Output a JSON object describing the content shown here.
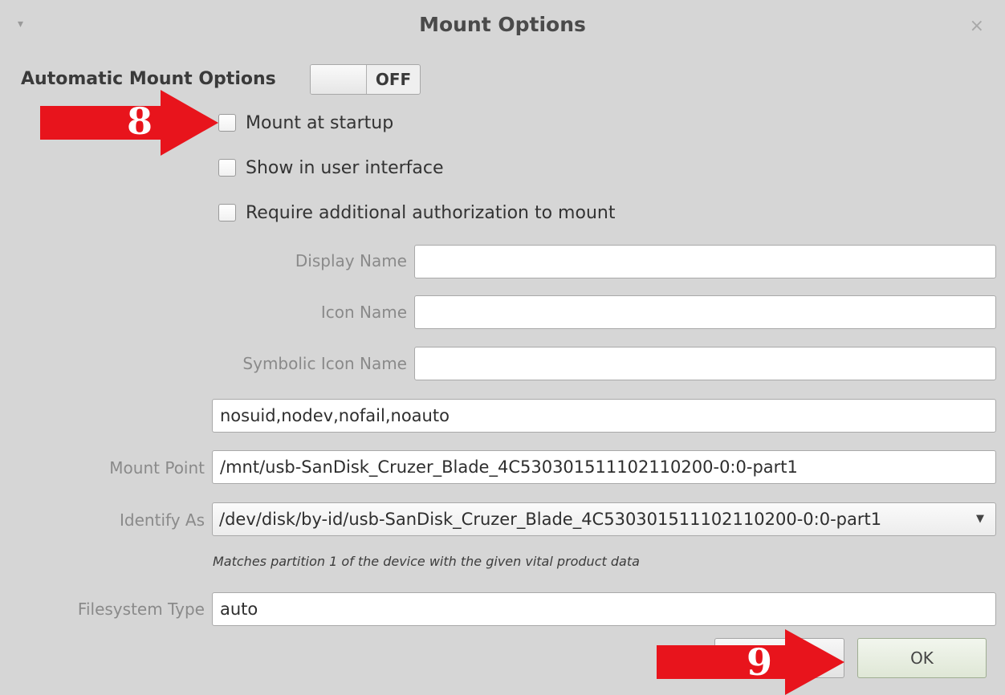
{
  "dialog": {
    "title": "Mount Options",
    "close_glyph": "×",
    "menu_glyph": "▾"
  },
  "automatic": {
    "label": "Automatic Mount Options",
    "switch_state": "OFF"
  },
  "checkboxes": [
    {
      "label": "Mount at startup",
      "checked": false
    },
    {
      "label": "Show in user interface",
      "checked": false
    },
    {
      "label": "Require additional authorization to mount",
      "checked": false
    }
  ],
  "fields": {
    "display_name": {
      "label": "Display Name",
      "value": ""
    },
    "icon_name": {
      "label": "Icon Name",
      "value": ""
    },
    "symbolic_icon_name": {
      "label": "Symbolic Icon Name",
      "value": ""
    },
    "options": {
      "value": "nosuid,nodev,nofail,noauto"
    },
    "mount_point": {
      "label": "Mount Point",
      "value": "/mnt/usb-SanDisk_Cruzer_Blade_4C530301511102110200-0:0-part1"
    },
    "identify_as": {
      "label": "Identify As",
      "value": "/dev/disk/by-id/usb-SanDisk_Cruzer_Blade_4C530301511102110200-0:0-part1"
    },
    "identify_hint": "Matches partition 1 of the device with the given vital product data",
    "filesystem_type": {
      "label": "Filesystem Type",
      "value": "auto"
    }
  },
  "buttons": {
    "ok_label": "OK"
  },
  "annotations": {
    "step_a": "8",
    "step_b": "9",
    "color": "#e8141c"
  },
  "icons": {
    "menu": "chevron-down-icon",
    "close": "close-icon",
    "combo": "dropdown-arrow-icon"
  }
}
